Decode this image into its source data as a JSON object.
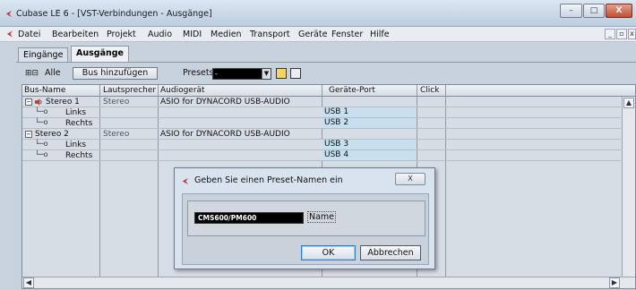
{
  "window": {
    "title": "Cubase LE 6 - [VST-Verbindungen - Ausgänge]",
    "controls": {
      "minimize": "–",
      "maximize": "□",
      "close": "X"
    }
  },
  "menu": {
    "items": [
      "Datei",
      "Bearbeiten",
      "Projekt",
      "Audio",
      "MIDI",
      "Medien",
      "Transport",
      "Geräte",
      "Fenster",
      "Hilfe"
    ],
    "mdi": {
      "minimize": "_",
      "restore": "▫",
      "close": "x"
    }
  },
  "tabs": [
    {
      "label": "Eingänge",
      "active": false
    },
    {
      "label": "Ausgänge",
      "active": true
    }
  ],
  "toolbar": {
    "expand_collapse": "⊞⊟",
    "all_label": "Alle",
    "add_bus_label": "Bus hinzufügen",
    "presets_label": "Presets",
    "presets_value": "-"
  },
  "table": {
    "headers": [
      "Bus-Name",
      "Lautsprecher",
      "Audiogerät",
      "Geräte-Port",
      "Click"
    ],
    "rows": [
      {
        "tree": "⊟",
        "name": "Stereo 1",
        "speaker": "Stereo",
        "device": "ASIO for DYNACORD USB-AUDIO",
        "port": "",
        "is_bus": true
      },
      {
        "tree": "",
        "name": "Links",
        "speaker": "",
        "device": "",
        "port": "USB 1",
        "is_bus": false
      },
      {
        "tree": "",
        "name": "Rechts",
        "speaker": "",
        "device": "",
        "port": "USB 2",
        "is_bus": false
      },
      {
        "tree": "⊟",
        "name": "Stereo 2",
        "speaker": "Stereo",
        "device": "ASIO for DYNACORD USB-AUDIO",
        "port": "",
        "is_bus": true
      },
      {
        "tree": "",
        "name": "Links",
        "speaker": "",
        "device": "",
        "port": "USB 3",
        "is_bus": false
      },
      {
        "tree": "",
        "name": "Rechts",
        "speaker": "",
        "device": "",
        "port": "USB 4",
        "is_bus": false
      }
    ]
  },
  "dialog": {
    "title": "Geben Sie einen Preset-Namen ein",
    "close": "X",
    "input_value": "CMS600/PM600",
    "name_label": "Name",
    "ok_label": "OK",
    "cancel_label": "Abbrechen"
  },
  "colors": {
    "port_highlight": "#c6e0ef",
    "app_accent": "#c8302a"
  },
  "icons": [
    "cubase-logo-icon",
    "speaker-icon",
    "preset-save-icon",
    "preset-remove-icon"
  ]
}
